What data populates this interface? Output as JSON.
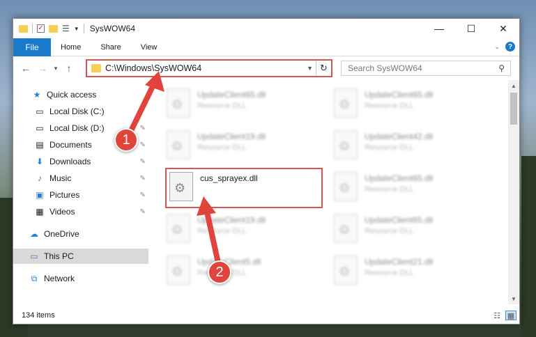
{
  "window": {
    "title": "SysWOW64",
    "controls": {
      "minimize": "—",
      "maximize": "☐",
      "close": "✕"
    }
  },
  "ribbon": {
    "tabs": [
      {
        "label": "File"
      },
      {
        "label": "Home"
      },
      {
        "label": "Share"
      },
      {
        "label": "View"
      }
    ]
  },
  "nav": {
    "address": "C:\\Windows\\SysWOW64",
    "search_placeholder": "Search SysWOW64"
  },
  "sidebar": {
    "items": [
      {
        "label": "Quick access",
        "icon": "star-icon"
      },
      {
        "label": "Local Disk (C:)",
        "icon": "drive-icon"
      },
      {
        "label": "Local Disk (D:)",
        "icon": "drive-icon",
        "pinned": true
      },
      {
        "label": "Documents",
        "icon": "documents-icon",
        "pinned": true
      },
      {
        "label": "Downloads",
        "icon": "download-icon",
        "pinned": true
      },
      {
        "label": "Music",
        "icon": "music-icon",
        "pinned": true
      },
      {
        "label": "Pictures",
        "icon": "pictures-icon",
        "pinned": true
      },
      {
        "label": "Videos",
        "icon": "videos-icon",
        "pinned": true
      },
      {
        "label": "OneDrive",
        "icon": "cloud-icon"
      },
      {
        "label": "This PC",
        "icon": "computer-icon",
        "selected": true
      },
      {
        "label": "Network",
        "icon": "network-icon"
      }
    ]
  },
  "files": {
    "left": [
      {
        "name": "UpdateClient65.dll",
        "desc": "Resource DLL"
      },
      {
        "name": "UpdateClient19.dll",
        "desc": "Resource DLL"
      },
      {
        "name": "cus_sprayex.dll",
        "desc": ""
      },
      {
        "name": "UpdateClient19.dll",
        "desc": "Resource DLL"
      },
      {
        "name": "UpdateClient5.dll",
        "desc": "Resource DLL"
      }
    ],
    "right": [
      {
        "name": "UpdateClient65.dll",
        "desc": "Resource DLL"
      },
      {
        "name": "UpdateClient42.dll",
        "desc": "Resource DLL"
      },
      {
        "name": "UpdateClient65.dll",
        "desc": "Resource DLL"
      },
      {
        "name": "UpdateClient65.dll",
        "desc": "Resource DLL"
      },
      {
        "name": "UpdateClient21.dll",
        "desc": "Resource DLL"
      }
    ]
  },
  "status": {
    "count": "134 items"
  },
  "annotations": {
    "step1": "1",
    "step2": "2",
    "color": "#e0443d"
  }
}
